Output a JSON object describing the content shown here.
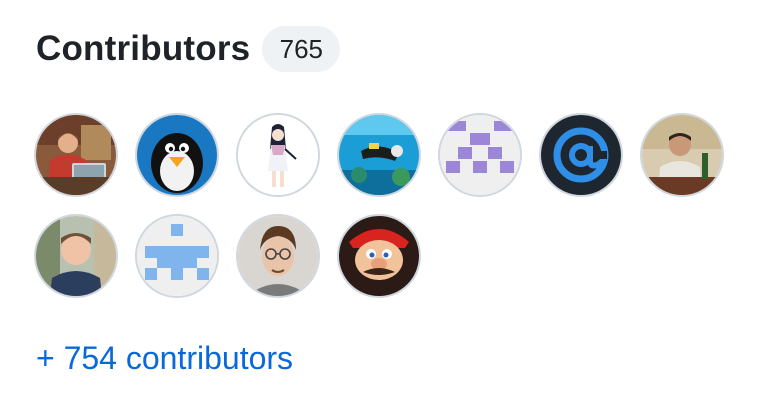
{
  "header": {
    "title": "Contributors",
    "count": "765"
  },
  "avatars": [
    {
      "name": "avatar-photo-kid-laptop"
    },
    {
      "name": "avatar-penguin"
    },
    {
      "name": "avatar-anime-character"
    },
    {
      "name": "avatar-underwater-diver"
    },
    {
      "name": "avatar-identicon-purple"
    },
    {
      "name": "avatar-at-sign"
    },
    {
      "name": "avatar-photo-man-table"
    },
    {
      "name": "avatar-photo-man-smiling"
    },
    {
      "name": "avatar-identicon-blue"
    },
    {
      "name": "avatar-photo-man-glasses"
    },
    {
      "name": "avatar-mario"
    }
  ],
  "footer": {
    "more_link": "+ 754 contributors"
  },
  "colors": {
    "link": "#0969da",
    "badge_bg": "#eff2f5",
    "avatar_border": "#d0d7de"
  }
}
